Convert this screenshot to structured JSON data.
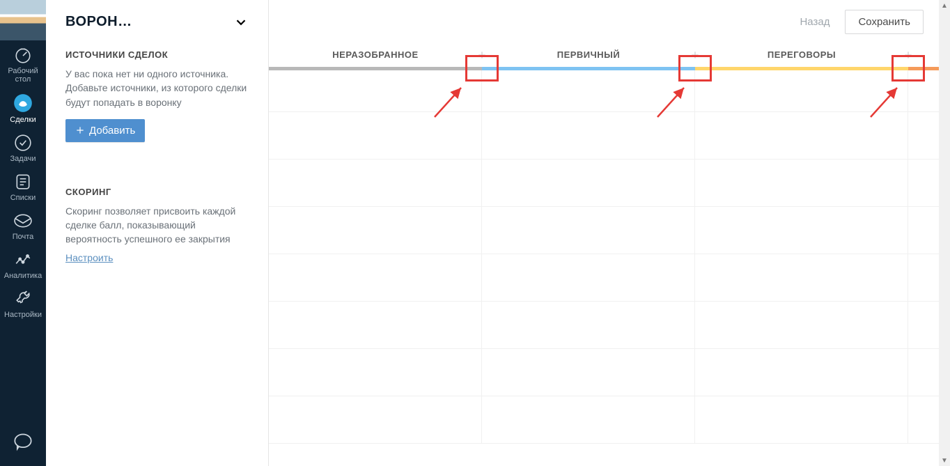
{
  "nav": {
    "items": [
      {
        "label": "Рабочий стол",
        "active": false
      },
      {
        "label": "Сделки",
        "active": true
      },
      {
        "label": "Задачи",
        "active": false
      },
      {
        "label": "Списки",
        "active": false
      },
      {
        "label": "Почта",
        "active": false
      },
      {
        "label": "Аналитика",
        "active": false
      },
      {
        "label": "Настройки",
        "active": false
      }
    ]
  },
  "funnel": {
    "title": "ВОРОН…"
  },
  "sources": {
    "heading": "ИСТОЧНИКИ СДЕЛОК",
    "description": "У вас пока нет ни одного источника. Добавьте источники, из которого сделки будут попадать в воронку",
    "add_label": "Добавить"
  },
  "scoring": {
    "heading": "СКОРИНГ",
    "description": "Скоринг позволяет присвоить каждой сделке балл, показывающий вероятность успешного ее закрытия",
    "link_label": "Настроить"
  },
  "topbar": {
    "back_label": "Назад",
    "save_label": "Сохранить"
  },
  "stages": [
    {
      "title": "НЕРАЗОБРАННОЕ",
      "color": "#b8b8b8"
    },
    {
      "title": "ПЕРВИЧНЫЙ",
      "color": "#7ec3f2"
    },
    {
      "title": "ПЕРЕГОВОРЫ",
      "color": "#ffd66b"
    },
    {
      "title": "",
      "color": "#f59b5a"
    }
  ],
  "colors": {
    "accent": "#4f8fcf",
    "highlight_border": "#e53935"
  }
}
